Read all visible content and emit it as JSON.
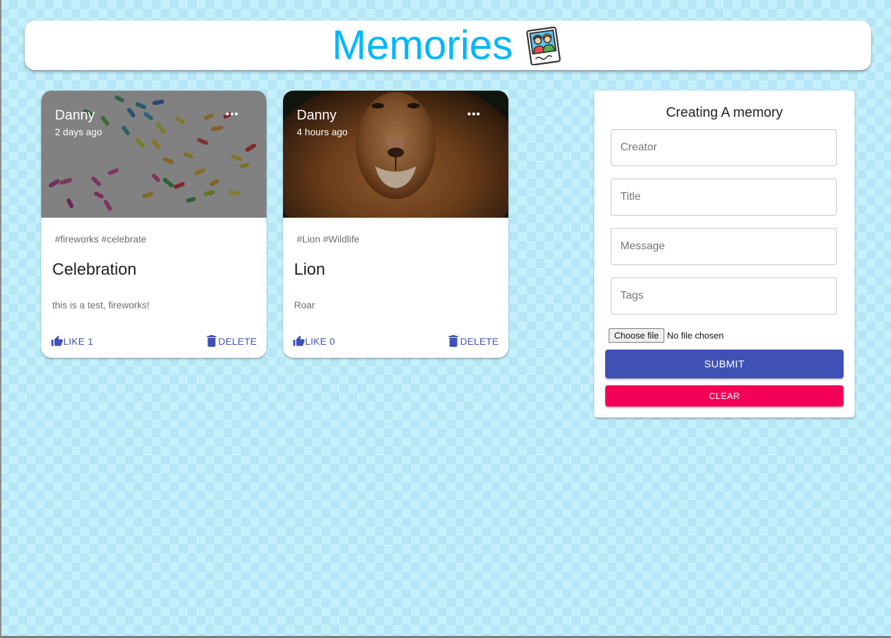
{
  "header": {
    "title": "Memories",
    "logo_icon": "photo-of-people-icon",
    "title_color": "#00b7ff"
  },
  "posts": [
    {
      "creator": "Danny",
      "time": "2 days ago",
      "tags": "#fireworks #celebrate",
      "title": "Celebration",
      "message": "this is a test, fireworks!",
      "like_label": "LIKE 1",
      "delete_label": "DELETE",
      "image": "fireworks-image"
    },
    {
      "creator": "Danny",
      "time": "4 hours ago",
      "tags": "#Lion #Wildlife",
      "title": "Lion",
      "message": "Roar",
      "like_label": "LIKE 0",
      "delete_label": "DELETE",
      "image": "lion-image"
    }
  ],
  "form": {
    "title": "Creating A memory",
    "creator_placeholder": "Creator",
    "title_placeholder": "Title",
    "message_placeholder": "Message",
    "tags_placeholder": "Tags",
    "file_button": "Choose file",
    "file_status": "No file chosen",
    "submit_label": "SUBMIT",
    "clear_label": "CLEAR"
  },
  "colors": {
    "primary": "#3f51b5",
    "secondary": "#f50057",
    "background": "#c4f0fc"
  }
}
